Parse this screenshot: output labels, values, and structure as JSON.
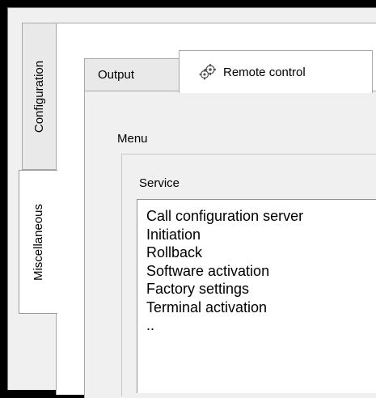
{
  "side_tabs": {
    "configuration": "Configuration",
    "miscellaneous": "Miscellaneous"
  },
  "tabs": {
    "output": "Output",
    "remote_control": "Remote control",
    "remote_control_icon": "gears-icon"
  },
  "menu": {
    "label": "Menu",
    "service_label": "Service",
    "service_items": [
      "Call configuration server",
      "Initiation",
      "Rollback",
      "Software activation",
      "Factory settings",
      "Terminal activation",
      ".."
    ]
  }
}
